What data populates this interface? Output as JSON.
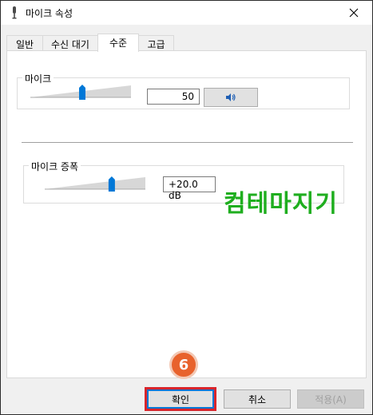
{
  "window": {
    "title": "마이크 속성",
    "close_symbol": "✕"
  },
  "tabs": [
    {
      "label": "일반",
      "active": false
    },
    {
      "label": "수신 대기",
      "active": false
    },
    {
      "label": "수준",
      "active": true
    },
    {
      "label": "고급",
      "active": false
    }
  ],
  "levels": {
    "microphone": {
      "label": "마이크",
      "value": "50",
      "level_fraction": 0.5,
      "speaker_icon": "speaker-icon"
    },
    "boost": {
      "label": "마이크 증폭",
      "value": "+20.0 dB",
      "level_fraction": 0.66
    }
  },
  "watermark": "컴테마지기",
  "buttons": {
    "ok": "확인",
    "cancel": "취소",
    "apply": "적용(A)"
  },
  "annotation": {
    "step": "6"
  },
  "colors": {
    "accent": "#0078d7",
    "highlight": "#d9252b",
    "badge": "#e8622c",
    "watermark": "#1fae1f"
  }
}
